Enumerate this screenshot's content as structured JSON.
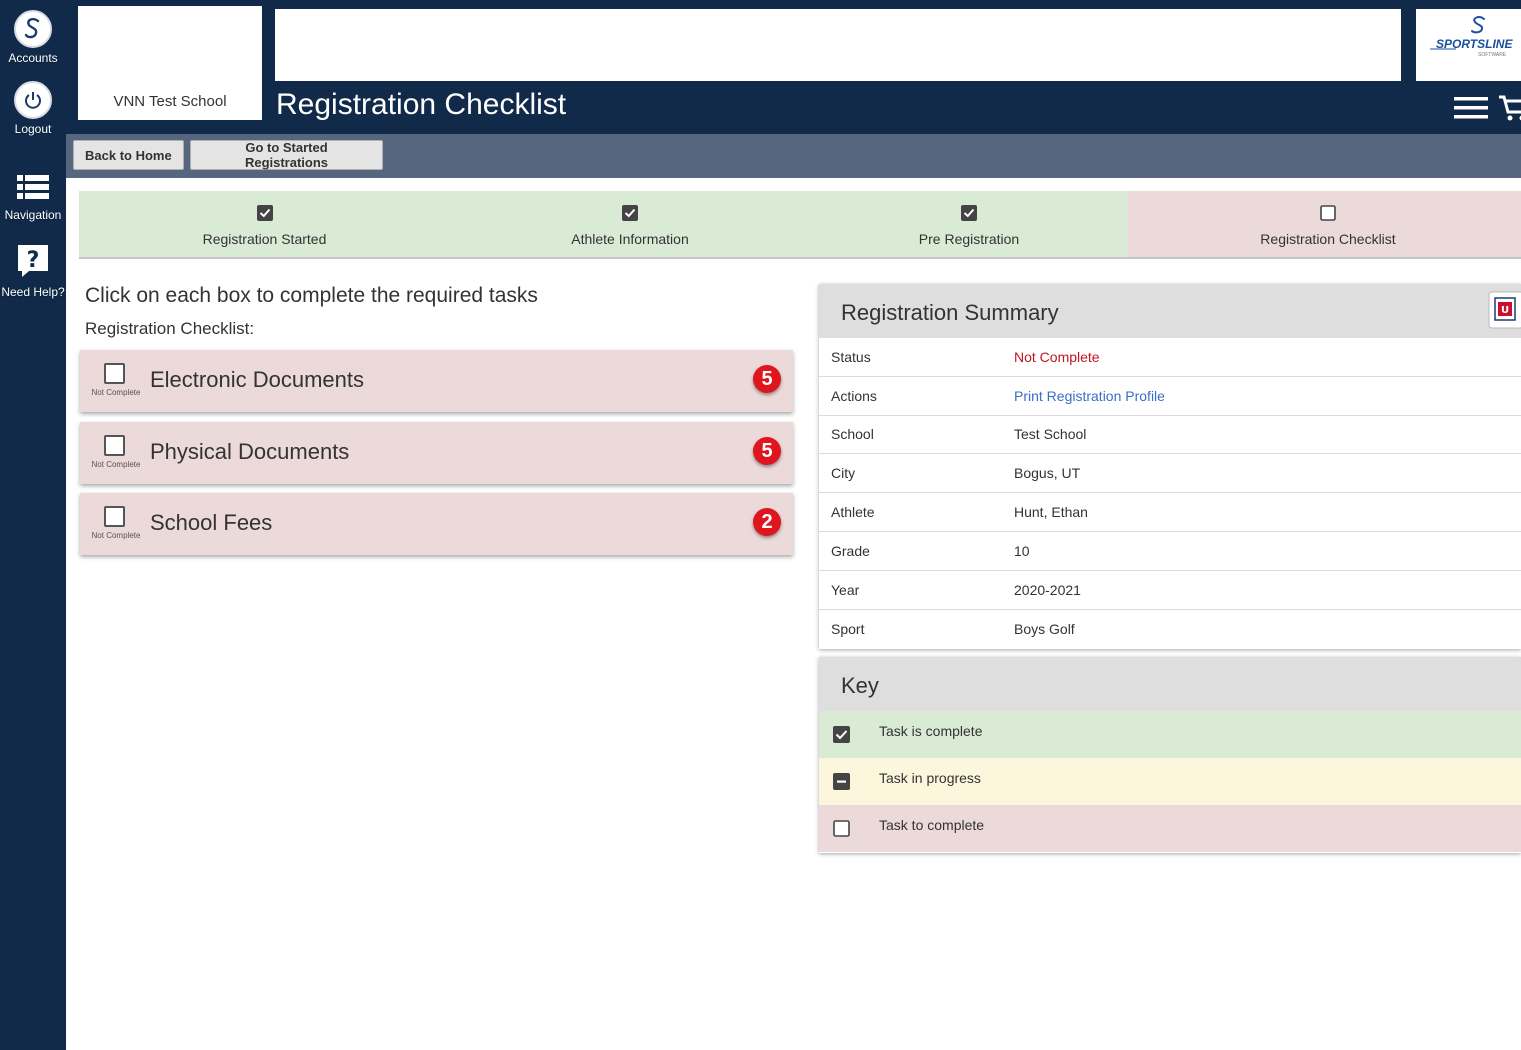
{
  "sidebar": {
    "accounts_label": "Accounts",
    "logout_label": "Logout",
    "navigation_label": "Navigation",
    "help_label": "Need Help?"
  },
  "header": {
    "school_name": "VNN Test School",
    "page_title": "Registration Checklist",
    "logo_text": "SPORTSLINE",
    "logo_subtext": "SOFTWARE"
  },
  "toolbar": {
    "home_label": "Back to Home",
    "started_label": "Go to Started Registrations"
  },
  "steps": [
    {
      "label": "Registration Started",
      "state": "complete"
    },
    {
      "label": "Athlete Information",
      "state": "complete"
    },
    {
      "label": "Pre Registration",
      "state": "complete"
    },
    {
      "label": "Registration Checklist",
      "state": "incomplete"
    }
  ],
  "checklist": {
    "instruction": "Click on each box to complete the required tasks",
    "subtitle": "Registration Checklist:",
    "tasks": [
      {
        "name": "Electronic Documents",
        "status": "Not Complete",
        "count": "5"
      },
      {
        "name": "Physical Documents",
        "status": "Not Complete",
        "count": "5"
      },
      {
        "name": "School Fees",
        "status": "Not Complete",
        "count": "2"
      }
    ]
  },
  "summary": {
    "title": "Registration Summary",
    "rows": [
      {
        "key": "Status",
        "value": "Not Complete"
      },
      {
        "key": "Actions",
        "value": "Print Registration Profile"
      },
      {
        "key": "School",
        "value": "Test School"
      },
      {
        "key": "City",
        "value": "Bogus, UT"
      },
      {
        "key": "Athlete",
        "value": "Hunt, Ethan"
      },
      {
        "key": "Grade",
        "value": "10"
      },
      {
        "key": "Year",
        "value": "2020-2021"
      },
      {
        "key": "Sport",
        "value": "Boys Golf"
      }
    ]
  },
  "key": {
    "title": "Key",
    "items": [
      {
        "label": "Task is complete"
      },
      {
        "label": "Task in progress"
      },
      {
        "label": "Task to complete"
      }
    ]
  },
  "colors": {
    "navy": "#112a4a",
    "toolbar": "#56667f",
    "complete_bg": "#d9ebd5",
    "incomplete_bg": "#ecd9da",
    "progress_bg": "#fbf6dc",
    "badge_red": "#e0161f",
    "link_blue": "#3a6fc7"
  }
}
